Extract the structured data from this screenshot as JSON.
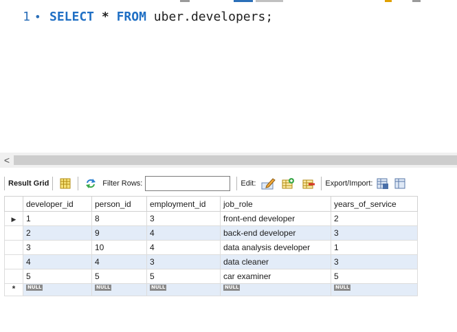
{
  "editor": {
    "line_number": "1",
    "line_marker": "•",
    "tokens": {
      "select": "SELECT",
      "star": "*",
      "from": "FROM",
      "table": "uber.developers;"
    }
  },
  "scrollbar": {
    "left_arrow": "<"
  },
  "toolbar": {
    "result_grid_label": "Result Grid",
    "filter_rows_label": "Filter Rows:",
    "filter_rows_value": "",
    "edit_label": "Edit:",
    "export_import_label": "Export/Import:"
  },
  "grid": {
    "columns": [
      "developer_id",
      "person_id",
      "employment_id",
      "job_role",
      "years_of_service"
    ],
    "rows": [
      [
        "1",
        "8",
        "3",
        "front-end developer",
        "2"
      ],
      [
        "2",
        "9",
        "4",
        "back-end developer",
        "3"
      ],
      [
        "3",
        "10",
        "4",
        "data analysis developer",
        "1"
      ],
      [
        "4",
        "4",
        "3",
        "data cleaner",
        "3"
      ],
      [
        "5",
        "5",
        "5",
        "car examiner",
        "5"
      ]
    ],
    "null_label": "NULL",
    "current_row_marker": "▶",
    "new_row_marker": "*"
  },
  "colors": {
    "keyword": "#1f6fc4",
    "alt_row": "#e3ecf8",
    "null_badge": "#8a8a8a"
  }
}
